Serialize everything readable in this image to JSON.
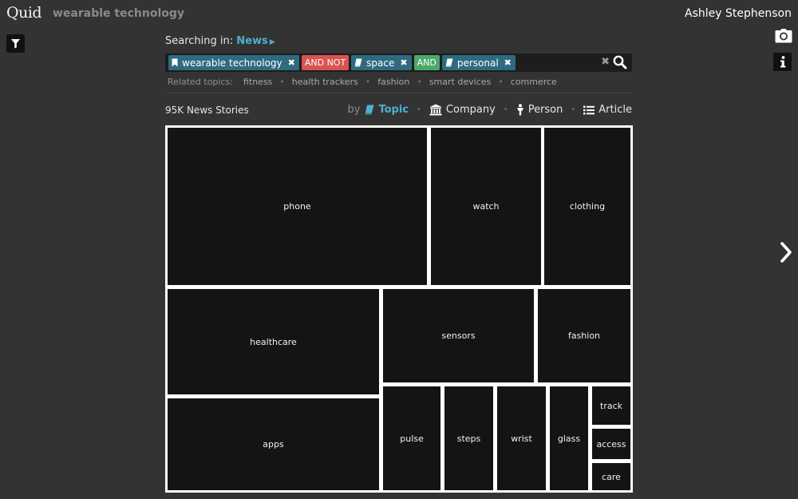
{
  "header": {
    "logo_text": "Quid",
    "app_title": "wearable technology",
    "user_name": "Ashley Stephenson"
  },
  "icons": {
    "filter": "filter-icon",
    "camera": "camera-icon",
    "info": "info-icon",
    "next": "chevron-right-icon",
    "search": "search-icon",
    "clear": "clear-icon"
  },
  "search": {
    "searching_label": "Searching in:",
    "source": "News",
    "chips": [
      {
        "label": "wearable technology",
        "icon": "bookmark-icon"
      },
      {
        "label": "space",
        "icon": "book-icon"
      },
      {
        "label": "personal",
        "icon": "book-icon"
      }
    ],
    "operators": [
      "AND NOT",
      "AND"
    ],
    "clear_glyph": "✖"
  },
  "related": {
    "label": "Related topics:",
    "items": [
      "fitness",
      "health trackers",
      "fashion",
      "smart devices",
      "commerce"
    ]
  },
  "results": {
    "count": "95K News Stories",
    "by_label": "by",
    "group_options": [
      "Topic",
      "Company",
      "Person",
      "Article"
    ],
    "active_option": "Topic"
  },
  "treemap": {
    "cells": [
      "phone",
      "watch",
      "clothing",
      "healthcare",
      "sensors",
      "fashion",
      "apps",
      "pulse",
      "steps",
      "wrist",
      "glass",
      "track",
      "access",
      "care"
    ]
  },
  "colors": {
    "background": "#333333",
    "accent": "#4fb0cf",
    "topic_chip": "#2e6b80",
    "and_not": "#d9534f",
    "and": "#4aaa6a",
    "tile": "#141414"
  }
}
